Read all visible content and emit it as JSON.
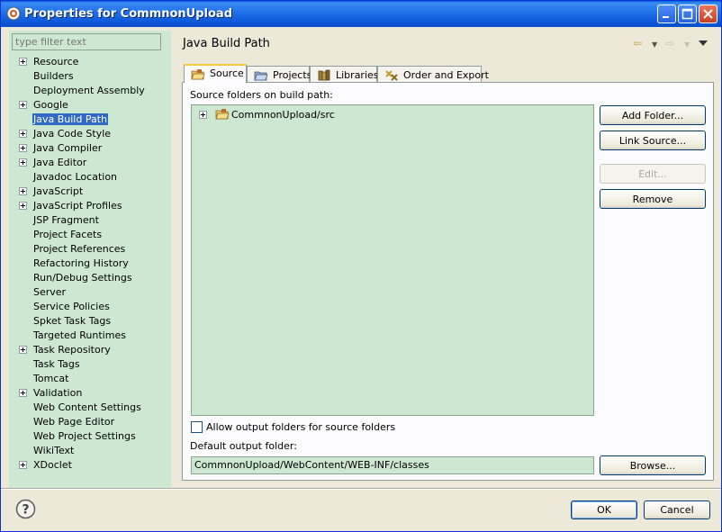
{
  "window": {
    "title": "Properties for CommnonUpload"
  },
  "filter": {
    "placeholder": "type filter text"
  },
  "tree": {
    "items": [
      {
        "label": "Resource",
        "expandable": true
      },
      {
        "label": "Builders",
        "expandable": false
      },
      {
        "label": "Deployment Assembly",
        "expandable": false
      },
      {
        "label": "Google",
        "expandable": true
      },
      {
        "label": "Java Build Path",
        "expandable": false,
        "selected": true
      },
      {
        "label": "Java Code Style",
        "expandable": true
      },
      {
        "label": "Java Compiler",
        "expandable": true
      },
      {
        "label": "Java Editor",
        "expandable": true
      },
      {
        "label": "Javadoc Location",
        "expandable": false
      },
      {
        "label": "JavaScript",
        "expandable": true
      },
      {
        "label": "JavaScript Profiles",
        "expandable": true
      },
      {
        "label": "JSP Fragment",
        "expandable": false
      },
      {
        "label": "Project Facets",
        "expandable": false
      },
      {
        "label": "Project References",
        "expandable": false
      },
      {
        "label": "Refactoring History",
        "expandable": false
      },
      {
        "label": "Run/Debug Settings",
        "expandable": false
      },
      {
        "label": "Server",
        "expandable": false
      },
      {
        "label": "Service Policies",
        "expandable": false
      },
      {
        "label": "Spket Task Tags",
        "expandable": false
      },
      {
        "label": "Targeted Runtimes",
        "expandable": false
      },
      {
        "label": "Task Repository",
        "expandable": true
      },
      {
        "label": "Task Tags",
        "expandable": false
      },
      {
        "label": "Tomcat",
        "expandable": false
      },
      {
        "label": "Validation",
        "expandable": true
      },
      {
        "label": "Web Content Settings",
        "expandable": false
      },
      {
        "label": "Web Page Editor",
        "expandable": false
      },
      {
        "label": "Web Project Settings",
        "expandable": false
      },
      {
        "label": "WikiText",
        "expandable": false
      },
      {
        "label": "XDoclet",
        "expandable": true
      }
    ]
  },
  "page": {
    "title": "Java Build Path"
  },
  "tabs": [
    {
      "label": "Source",
      "icon": "source-folder-icon",
      "active": true
    },
    {
      "label": "Projects",
      "icon": "projects-folder-icon",
      "active": false
    },
    {
      "label": "Libraries",
      "icon": "libraries-icon",
      "active": false
    },
    {
      "label": "Order and Export",
      "icon": "order-export-icon",
      "active": false
    }
  ],
  "source": {
    "section_label": "Source folders on build path:",
    "folders": [
      {
        "label": "CommnonUpload/src"
      }
    ],
    "buttons": {
      "add_folder": "Add Folder...",
      "link_source": "Link Source...",
      "edit": "Edit...",
      "remove": "Remove"
    },
    "allow_output_label": "Allow output folders for source folders",
    "allow_output_checked": false,
    "output_label": "Default output folder:",
    "output_value": "CommnonUpload/WebContent/WEB-INF/classes",
    "browse": "Browse..."
  },
  "footer": {
    "ok": "OK",
    "cancel": "Cancel"
  },
  "colors": {
    "title_bar": "#0b56d6",
    "panel_green": "#cde8d0",
    "selection": "#316ac5",
    "active_tab_accent": "#ffc83c"
  }
}
